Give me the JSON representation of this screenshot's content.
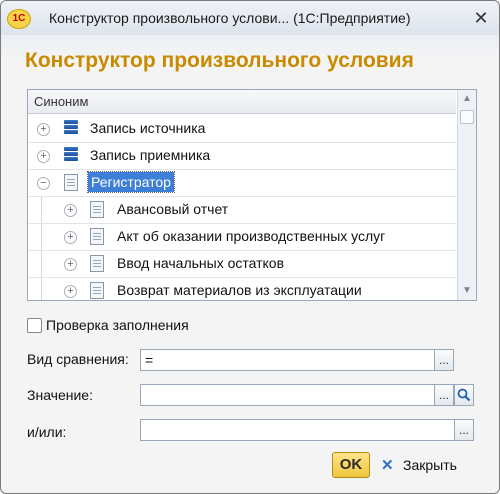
{
  "window": {
    "title": "Конструктор произвольного услови...  (1С:Предприятие)",
    "app_icon_text": "1С",
    "close_glyph": "✕"
  },
  "heading": "Конструктор произвольного условия",
  "tree": {
    "column_header": "Синоним",
    "rows": [
      {
        "label": "Запись источника",
        "level": 0,
        "expander": "+",
        "icon": "register-stack-icon"
      },
      {
        "label": "Запись приемника",
        "level": 0,
        "expander": "+",
        "icon": "register-stack-icon"
      },
      {
        "label": "Регистратор",
        "level": 0,
        "expander": "−",
        "icon": "document-icon",
        "selected": true
      },
      {
        "label": "Авансовый отчет",
        "level": 1,
        "expander": "+",
        "icon": "document-icon"
      },
      {
        "label": "Акт об оказании производственных услуг",
        "level": 1,
        "expander": "+",
        "icon": "document-icon"
      },
      {
        "label": "Ввод начальных остатков",
        "level": 1,
        "expander": "+",
        "icon": "document-icon"
      },
      {
        "label": "Возврат материалов из эксплуатации",
        "level": 1,
        "expander": "+",
        "icon": "document-icon"
      }
    ],
    "scroll_up": "▲",
    "scroll_down": "▼"
  },
  "check": {
    "label": "Проверка заполнения",
    "checked": false
  },
  "fields": {
    "comparison_label": "Вид сравнения:",
    "comparison_value": "=",
    "value_label": "Значение:",
    "value_value": "",
    "andor_label": "и/или:",
    "andor_value": "",
    "ellipsis": "...",
    "search_glyph": "🔍"
  },
  "buttons": {
    "ok": "OK",
    "close": "Закрыть",
    "close_glyph": "✕"
  }
}
